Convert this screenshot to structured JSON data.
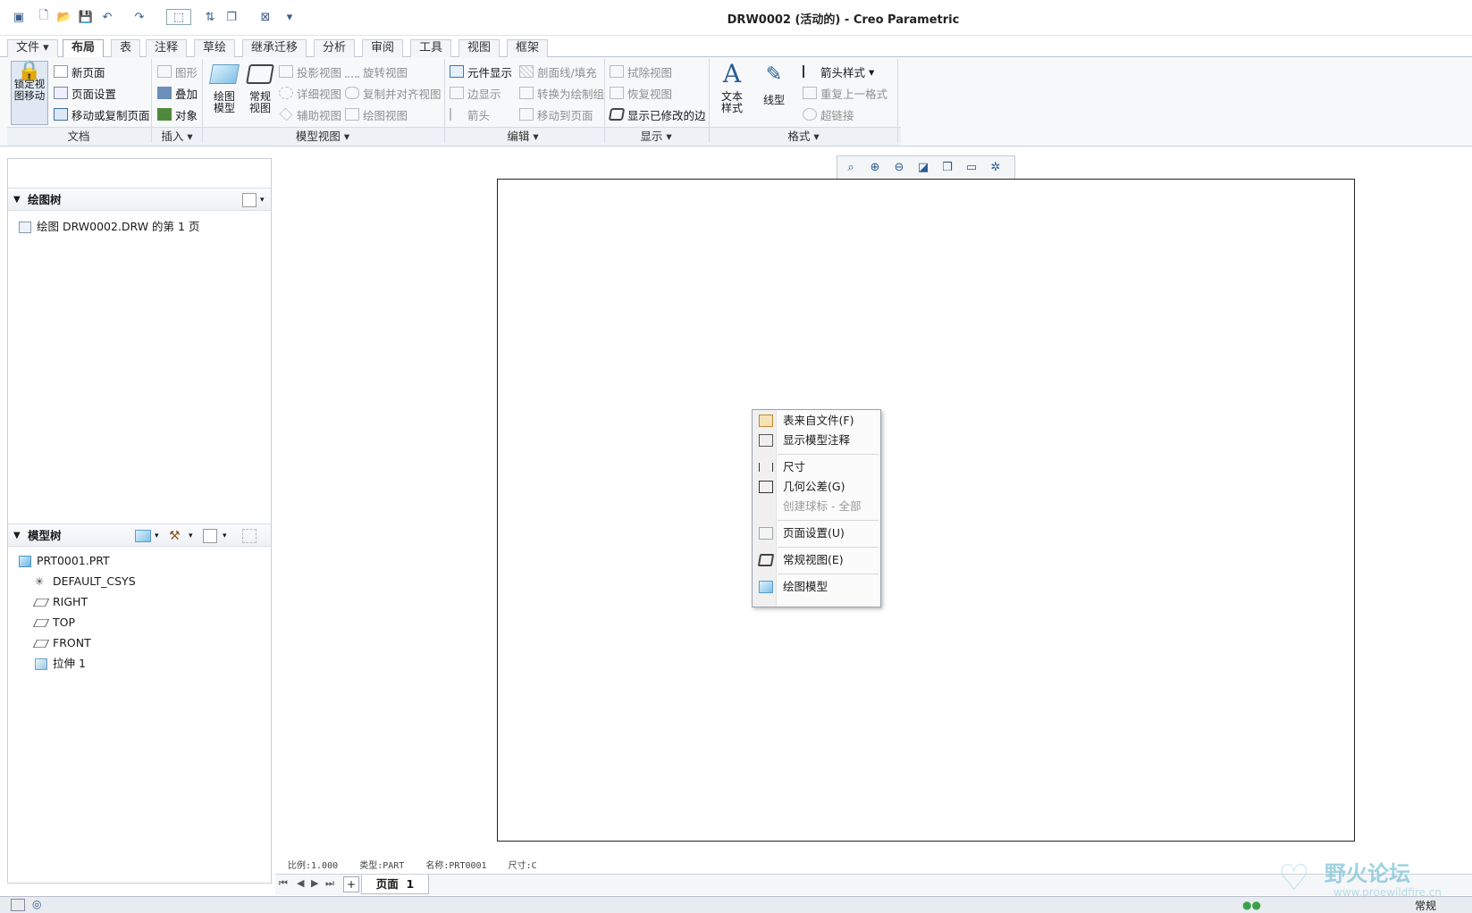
{
  "window": {
    "title": "DRW0002 (活动的) - Creo Parametric"
  },
  "tabs": [
    "文件",
    "布局",
    "表",
    "注释",
    "草绘",
    "继承迁移",
    "分析",
    "审阅",
    "工具",
    "视图",
    "框架"
  ],
  "ribbon": {
    "doc": {
      "lock_label": "锁定视\n图移动",
      "new_page": "新页面",
      "page_setup": "页面设置",
      "move_copy_page": "移动或复制页面",
      "group": "文档"
    },
    "insert": {
      "graphics": "图形",
      "overlay": "叠加",
      "object": "对象",
      "group": "插入"
    },
    "model_views": {
      "drawing_model": "绘图\n模型",
      "general_view": "常规\n视图",
      "projection": "投影视图",
      "detail": "详细视图",
      "auxiliary": "辅助视图",
      "revolve": "旋转视图",
      "copy_align": "复制并对齐视图",
      "drawing_view": "绘图视图",
      "group": "模型视图"
    },
    "edit": {
      "element_display": "元件显示",
      "edge_display": "边显示",
      "arrow": "箭头",
      "xhatch": "剖面线/填充",
      "convert_group": "转换为绘制组",
      "move_to_page": "移动到页面",
      "group": "编辑"
    },
    "display": {
      "erase_view": "拭除视图",
      "resume_view": "恢复视图",
      "show_modified_edges": "显示已修改的边",
      "group": "显示"
    },
    "format": {
      "text_style": "文本\n样式",
      "line_style": "线型",
      "arrow_style": "箭头样式",
      "repeat_last": "重复上一格式",
      "hyperlink": "超链接",
      "group": "格式"
    }
  },
  "drawing_tree": {
    "title": "绘图树",
    "item": "绘图 DRW0002.DRW 的第 1 页"
  },
  "model_tree": {
    "title": "模型树",
    "items": [
      "PRT0001.PRT",
      "DEFAULT_CSYS",
      "RIGHT",
      "TOP",
      "FRONT",
      "拉伸 1"
    ]
  },
  "context_menu": {
    "items": [
      {
        "label": "表来自文件(F)",
        "icon": "table-file-icon",
        "disabled": false
      },
      {
        "label": "显示模型注释",
        "icon": "model-annotation-icon",
        "disabled": false
      },
      {
        "label": "尺寸",
        "icon": "dimension-icon",
        "disabled": false
      },
      {
        "label": "几何公差(G)",
        "icon": "gtol-icon",
        "disabled": false
      },
      {
        "label": "创建球标 - 全部",
        "icon": "",
        "disabled": true
      },
      {
        "label": "页面设置(U)",
        "icon": "page-setup-icon",
        "disabled": false
      },
      {
        "label": "常规视图(E)",
        "icon": "general-view-icon",
        "disabled": false
      },
      {
        "label": "绘图模型",
        "icon": "drawing-model-icon",
        "disabled": false
      }
    ]
  },
  "status_info": "比例:1.000    类型:PART    名称:PRT0001    尺寸:C",
  "page_tab": {
    "label": "页面",
    "number": "1"
  },
  "statusbar": {
    "right_label": "常规"
  },
  "watermark": {
    "title": "野火论坛",
    "url": "www.proewildfire.cn"
  },
  "colors": {
    "accent": "#2c5a95",
    "sheet_border": "#222222",
    "watermark": "#7fc3d9"
  }
}
